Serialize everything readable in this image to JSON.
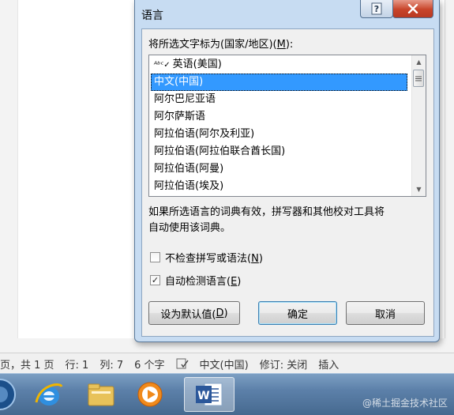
{
  "dialog": {
    "title": "语言",
    "prompt_prefix": "将所选文字标为(国家/地区)(",
    "prompt_key": "M",
    "prompt_suffix": "):",
    "languages": [
      {
        "label": "英语(美国)",
        "proofing": true
      },
      {
        "label": "中文(中国)",
        "selected": true
      },
      {
        "label": "阿尔巴尼亚语"
      },
      {
        "label": "阿尔萨斯语"
      },
      {
        "label": "阿拉伯语(阿尔及利亚)"
      },
      {
        "label": "阿拉伯语(阿拉伯联合酋长国)"
      },
      {
        "label": "阿拉伯语(阿曼)"
      },
      {
        "label": "阿拉伯语(埃及)"
      }
    ],
    "info_line1": "如果所选语言的词典有效，拼写器和其他校对工具将",
    "info_line2": "自动使用该词典。",
    "no_check": {
      "prefix": "不检查拼写或语法(",
      "key": "N",
      "suffix": ")",
      "checked": false
    },
    "auto_detect": {
      "prefix": "自动检测语言(",
      "key": "E",
      "suffix": ")",
      "checked": true
    },
    "set_default": {
      "prefix": "设为默认值(",
      "key": "D",
      "suffix": ")"
    },
    "ok_label": "确定",
    "cancel_label": "取消"
  },
  "status_bar": {
    "page": "页，共 1 页",
    "line": "行: 1",
    "column": "列: 7",
    "chars": "6 个字",
    "language": "中文(中国)",
    "track_changes": "修订: 关闭",
    "mode": "插入"
  },
  "taskbar": {
    "apps": [
      "start-orb",
      "internet-explorer",
      "file-explorer",
      "media-player",
      "word"
    ],
    "watermark": "@稀土掘金技术社区"
  }
}
